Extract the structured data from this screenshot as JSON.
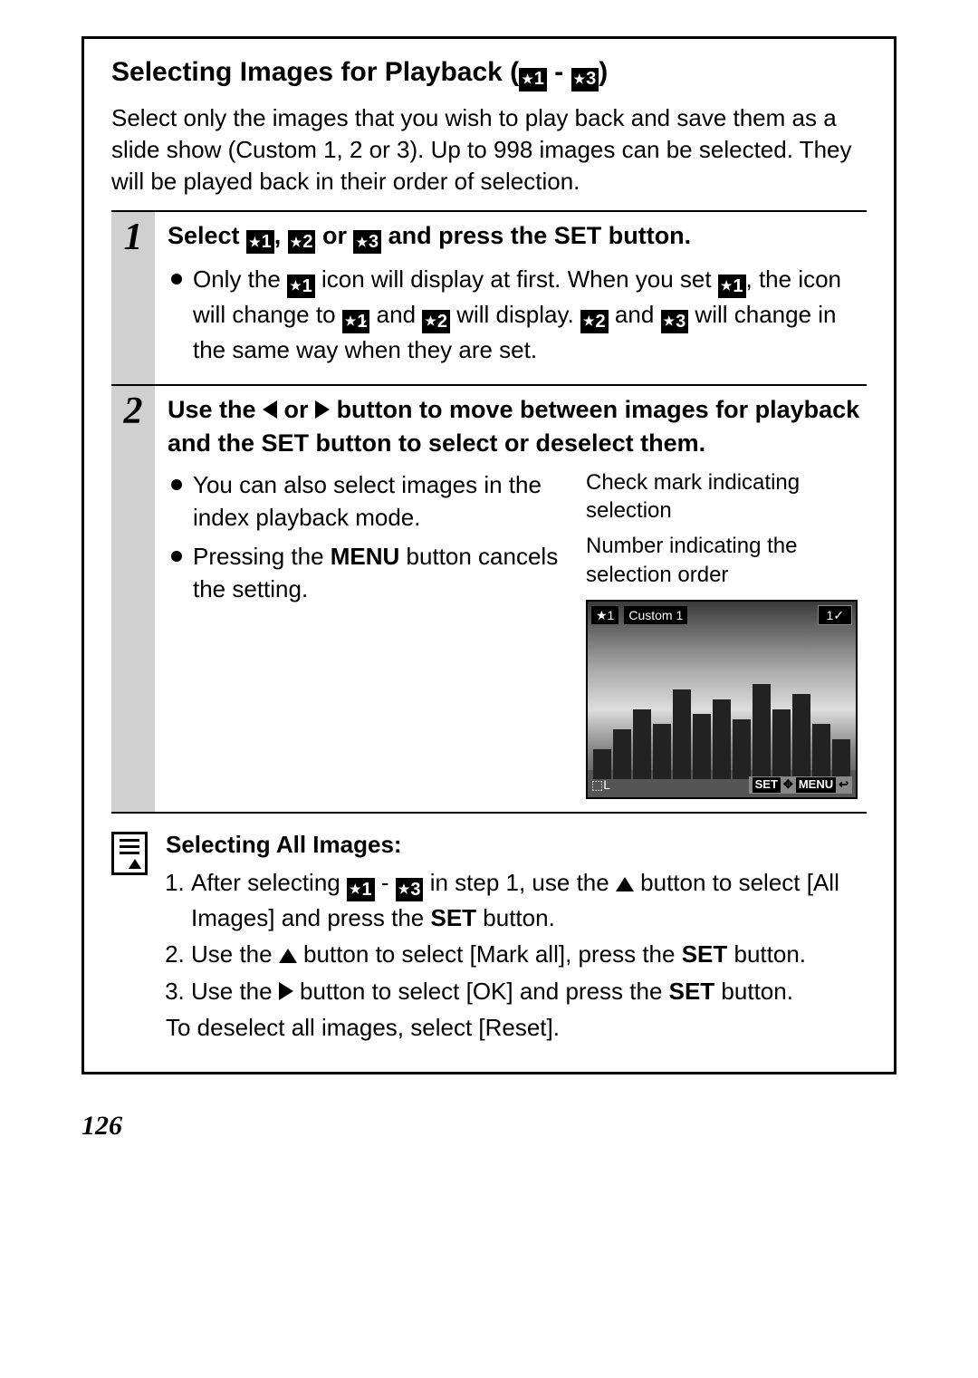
{
  "title_pre": "Selecting Images for Playback (",
  "title_post": ")",
  "icons": {
    "i1": "1",
    "i2": "2",
    "i3": "3",
    "i1v": "1"
  },
  "intro": "Select only the images that you wish to play back and save them as a slide show (Custom 1, 2 or 3). Up to 998 images can be selected. They will be played back in their order of selection.",
  "step1": {
    "num": "1",
    "head_a": "Select ",
    "head_b": ", ",
    "head_c": " or ",
    "head_d": " and press the SET button.",
    "b1a": "Only the ",
    "b1b": " icon will display at first. When you set ",
    "b1c": ", the icon will change to ",
    "b1d": " and ",
    "b1e": " will display. ",
    "b1f": " and ",
    "b1g": " will change in the same way when they are set."
  },
  "step2": {
    "num": "2",
    "head_a": "Use the ",
    "head_b": " or ",
    "head_c": " button to move between images for playback and the SET button to select or deselect them.",
    "bl1": "You can also select images in the index playback mode.",
    "bl2a": "Pressing the ",
    "bl2b": "MENU",
    "bl2c": " button cancels the setting.",
    "anno1": "Check mark indicating selection",
    "anno2": "Number indicating the selection order",
    "lcd": {
      "chip_star": "★1",
      "chip_label": "Custom 1",
      "badge": "1✓",
      "bot_left": "⬚L",
      "bot_set": "SET",
      "bot_mid": "✥",
      "bot_menu": "MENU",
      "bot_ret": "↩"
    }
  },
  "tip": {
    "title": "Selecting All Images:",
    "l1a": "After selecting ",
    "l1b": " - ",
    "l1c": " in step 1, use the ",
    "l1d": " button to select [All Images] and press the ",
    "l1e": "SET",
    "l1f": " button.",
    "l2a": "Use the ",
    "l2b": " button to select [Mark all], press the ",
    "l2c": "SET",
    "l2d": " button.",
    "l3a": "Use the ",
    "l3b": " button to select [OK] and press the ",
    "l3c": "SET",
    "l3d": " button.",
    "foot": "To deselect all images, select [Reset]."
  },
  "page": "126"
}
